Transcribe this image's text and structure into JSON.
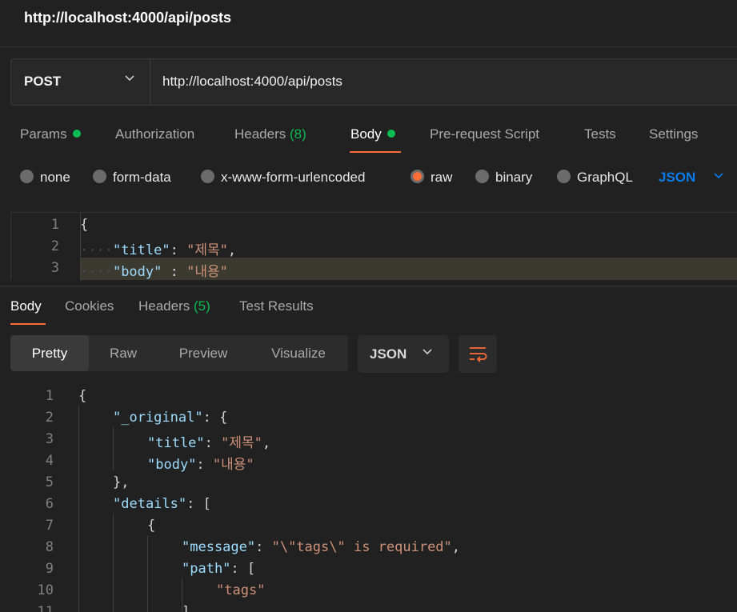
{
  "window": {
    "title": "http://localhost:4000/api/posts"
  },
  "request": {
    "method": "POST",
    "url": "http://localhost:4000/api/posts",
    "tabs": [
      {
        "label": "Params",
        "badge_dot": true
      },
      {
        "label": "Authorization"
      },
      {
        "label": "Headers",
        "count": "(8)"
      },
      {
        "label": "Body",
        "badge_dot": true,
        "active": true
      },
      {
        "label": "Pre-request Script"
      },
      {
        "label": "Tests"
      },
      {
        "label": "Settings"
      }
    ],
    "body_types": [
      {
        "label": "none",
        "selected": false
      },
      {
        "label": "form-data",
        "selected": false
      },
      {
        "label": "x-www-form-urlencoded",
        "selected": false
      },
      {
        "label": "raw",
        "selected": true
      },
      {
        "label": "binary",
        "selected": false
      },
      {
        "label": "GraphQL",
        "selected": false
      }
    ],
    "raw_format": "JSON",
    "editor": {
      "line_numbers": [
        "1",
        "2",
        "3"
      ],
      "line1": "{",
      "line2_key": "\"title\"",
      "line2_sep": ": ",
      "line2_val": "\"제목\"",
      "line2_end": ",",
      "line3_key": "\"body\"",
      "line3_sep": " : ",
      "line3_val": "\"내용\""
    }
  },
  "response": {
    "tabs": [
      {
        "label": "Body",
        "active": true
      },
      {
        "label": "Cookies"
      },
      {
        "label": "Headers",
        "count": "(5)"
      },
      {
        "label": "Test Results"
      }
    ],
    "views": [
      "Pretty",
      "Raw",
      "Preview",
      "Visualize"
    ],
    "active_view": "Pretty",
    "format": "JSON",
    "wrap_icon": "wrap-lines-icon",
    "line_numbers": [
      "1",
      "2",
      "3",
      "4",
      "5",
      "6",
      "7",
      "8",
      "9",
      "10",
      "11"
    ],
    "code": {
      "l1": "{",
      "l2_key": "\"_original\"",
      "l2_rest": ": {",
      "l3_key": "\"title\"",
      "l3_sep": ": ",
      "l3_val": "\"제목\"",
      "l3_end": ",",
      "l4_key": "\"body\"",
      "l4_sep": ": ",
      "l4_val": "\"내용\"",
      "l5": "},",
      "l6_key": "\"details\"",
      "l6_rest": ": [",
      "l7": "{",
      "l8_key": "\"message\"",
      "l8_sep": ": ",
      "l8_val": "\"\\\"tags\\\" is required\"",
      "l8_end": ",",
      "l9_key": "\"path\"",
      "l9_rest": ": [",
      "l10_val": "\"tags\"",
      "l11": "],"
    }
  },
  "colors": {
    "accent": "#ff6c37",
    "success": "#0cbb52",
    "link_blue": "#097bed",
    "background": "#212121"
  }
}
